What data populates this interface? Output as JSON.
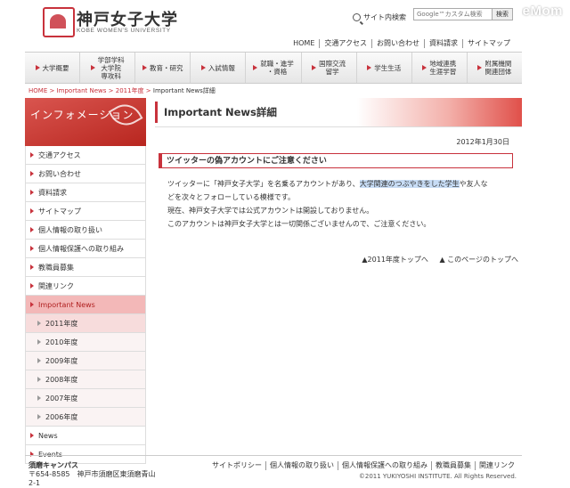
{
  "watermark": "ReseMom",
  "header": {
    "logo_ja": "神戸女子大学",
    "logo_en": "KOBE WOMEN'S UNIVERSITY",
    "site_search_label": "サイト内検索",
    "search_placeholder": "Google™カスタム検索",
    "search_button": "検索"
  },
  "topnav": [
    "HOME",
    "交通アクセス",
    "お問い合わせ",
    "資料請求",
    "サイトマップ"
  ],
  "mainnav": [
    "大学概要",
    "学部学科\n大学院\n専攻科",
    "教育・研究",
    "入試情報",
    "就職・進学\n・資格",
    "国際交流\n留学",
    "学生生活",
    "地域連携\n生涯学習",
    "附属機関\n関連団体"
  ],
  "breadcrumb": {
    "home": "HOME",
    "l1": "Important News",
    "l2": "2011年度",
    "current": "Important News詳細"
  },
  "sidebar": {
    "heading": "インフォメーション",
    "items": [
      "交通アクセス",
      "お問い合わせ",
      "資料請求",
      "サイトマップ",
      "個人情報の取り扱い",
      "個人情報保護への取り組み",
      "教職員募集",
      "関連リンク",
      "Important News"
    ],
    "sub_items": [
      "2011年度",
      "2010年度",
      "2009年度",
      "2008年度",
      "2007年度",
      "2006年度"
    ],
    "bottom_items": [
      "News",
      "Events"
    ]
  },
  "content": {
    "title": "Important News詳細",
    "date": "2012年1月30日",
    "news_title": "ツイッターの偽アカウントにご注意ください",
    "p1_a": "ツイッターに「神戸女子大学」を名乗るアカウントがあり、",
    "p1_hl": "大学関連のつぶやきをした学生",
    "p1_b": "や友人な",
    "p1_c": "どを次々とフォローしている模様です。",
    "p2": "現在、神戸女子大学では公式アカウントは開設しておりません。",
    "p3": "このアカウントは神戸女子大学とは一切関係ございませんので、ご注意ください。",
    "link_year_top": "▲2011年度トップへ",
    "link_page_top": "▲ このページのトップへ"
  },
  "footer": {
    "campus_name": "須磨キャンパス",
    "address": "〒654-8585　神戸市須磨区東須磨青山",
    "address2": "2-1",
    "nav": [
      "サイトポリシー",
      "個人情報の取り扱い",
      "個人情報保護への取り組み",
      "教職員募集",
      "関連リンク"
    ],
    "copyright": "©2011 YUKIYOSHI INSTITUTE. All Rights Reserved."
  },
  "colors": {
    "accent": "#c8323c",
    "active_bg": "#f3b8b8"
  }
}
